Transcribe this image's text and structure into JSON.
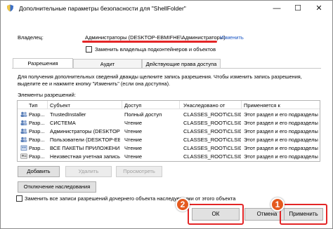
{
  "window": {
    "title": "Дополнительные параметры безопасности  для  \"ShellFolder\"",
    "minimize": "—",
    "maximize": "☐",
    "close": "✕"
  },
  "owner": {
    "label": "Владелец:",
    "value": "Администраторы (DESKTOP-EBMIFHE\\Администраторы)",
    "change_link": "Изменить",
    "replace_owner_checkbox": "Заменить владельца подконтейнеров и объектов"
  },
  "tabs": [
    {
      "label": "Разрешения",
      "active": true
    },
    {
      "label": "Аудит",
      "active": false
    },
    {
      "label": "Действующие права доступа",
      "active": false
    }
  ],
  "description": "Для получения дополнительных сведений дважды щелкните запись разрешения. Чтобы изменить запись разрешения, выделите ее и нажмите кнопку \"Изменить\" (если она доступна).",
  "entries_label": "Элементы разрешений:",
  "columns": [
    "Тип",
    "Субъект",
    "Доступ",
    "Унаследовано от",
    "Применяется к"
  ],
  "rows": [
    {
      "type": "Разр...",
      "subject": "TrustedInstaller",
      "access": "Полный доступ",
      "inherited": "CLASSES_ROOT\\CLSID\\...",
      "applies": "Этот раздел и его подразделы",
      "icon": "user-group-icon"
    },
    {
      "type": "Разр...",
      "subject": "СИСТЕМА",
      "access": "Чтение",
      "inherited": "CLASSES_ROOT\\CLSID\\...",
      "applies": "Этот раздел и его подразделы",
      "icon": "user-group-icon"
    },
    {
      "type": "Разр...",
      "subject": "Администраторы (DESKTOP-...",
      "access": "Чтение",
      "inherited": "CLASSES_ROOT\\CLSID\\...",
      "applies": "Этот раздел и его подразделы",
      "icon": "user-group-icon"
    },
    {
      "type": "Разр...",
      "subject": "Пользователи (DESKTOP-EBM...",
      "access": "Чтение",
      "inherited": "CLASSES_ROOT\\CLSID\\...",
      "applies": "Этот раздел и его подразделы",
      "icon": "user-group-icon"
    },
    {
      "type": "Разр...",
      "subject": "ВСЕ ПАКЕТЫ ПРИЛОЖЕНИЙ",
      "access": "Чтение",
      "inherited": "CLASSES_ROOT\\CLSID\\...",
      "applies": "Этот раздел и его подразделы",
      "icon": "package-icon"
    },
    {
      "type": "Разр...",
      "subject": "Неизвестная учетная запись...",
      "access": "Чтение",
      "inherited": "CLASSES_ROOT\\CLSID\\...",
      "applies": "Этот раздел и его подразделы",
      "icon": "unknown-account-icon"
    }
  ],
  "buttons": {
    "add": "Добавить",
    "remove": "Удалить",
    "view": "Просмотреть",
    "disable_inheritance": "Отключение наследования",
    "ok": "ОК",
    "cancel": "Отмена",
    "apply": "Применить"
  },
  "replace_child_checkbox": "Заменить все записи разрешений дочернего объекта наследуемыми от этого объекта",
  "markers": {
    "ok_step": "2",
    "apply_step": "1"
  },
  "colors": {
    "highlight_red": "#e32526",
    "marker_orange": "#e45a1f",
    "link_blue": "#1a56c4"
  }
}
